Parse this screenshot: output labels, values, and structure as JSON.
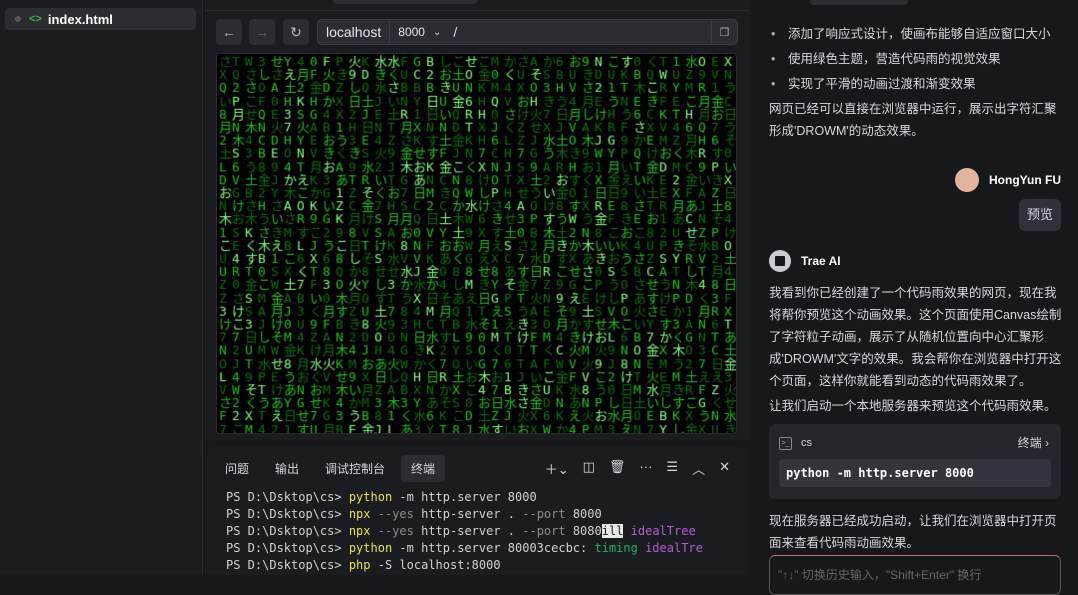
{
  "sidebar": {
    "file": "index.html"
  },
  "browser": {
    "host": "localhost",
    "port": "8000",
    "path": "/",
    "matrix_charset": "JBKLEYAMRFOX4267Z9UVCGSTHPDWNQ8310日月火水木土金あいうえおかきくけこさしすせそ"
  },
  "terminal": {
    "tabs": [
      "问题",
      "输出",
      "调试控制台",
      "终端"
    ],
    "prompt": "PS D:\\Dsktop\\cs> ",
    "lines": [
      {
        "cmd": "python",
        "rest": " -m http.server 8000"
      },
      {
        "cmd": "npx",
        "flag": " --yes",
        "rest": " http-server . ",
        "flag2": "--port",
        "rest2": " 8000"
      },
      {
        "cmd": "npx",
        "flag": " --yes",
        "rest": " http-server . ",
        "flag2": "--port",
        "rest2": " 8080",
        "sel": "ill",
        "tail": " idealTree"
      },
      {
        "cmd": "python",
        "rest": " -m http.server 80003cecbc: ",
        "timing": "timing",
        "tail": " idealTre"
      },
      {
        "cmd": "php",
        "rest": " -S localhost:8000"
      }
    ]
  },
  "chat": {
    "bullets": [
      "添加了响应式设计，使画布能够自适应窗口大小",
      "使用绿色主题，营造代码雨的视觉效果",
      "实现了平滑的动画过渡和渐变效果"
    ],
    "summary": "网页已经可以直接在浏览器中运行，展示出字符汇聚形成'DROWM'的动态效果。",
    "user_name": "HongYun FU",
    "user_message": "预览",
    "ai_name": "Trae AI",
    "ai_para1": "我看到你已经创建了一个代码雨效果的网页，现在我将帮你预览这个动画效果。这个页面使用Canvas绘制了字符粒子动画，展示了从随机位置向中心汇聚形成'DROWM'文字的效果。我会帮你在浏览器中打开这个页面，这样你就能看到动态的代码雨效果了。",
    "ai_para2": "让我们启动一个本地服务器来预览这个代码雨效果。",
    "cmd_dir": "cs",
    "cmd_open": "终端",
    "command": "python -m http.server 8000",
    "ai_para3": "现在服务器已经成功启动，让我们在浏览器中打开页面来查看代码雨动画效果。",
    "input_placeholder": "\"↑↓\" 切换历史输入，\"Shift+Enter\" 换行"
  }
}
